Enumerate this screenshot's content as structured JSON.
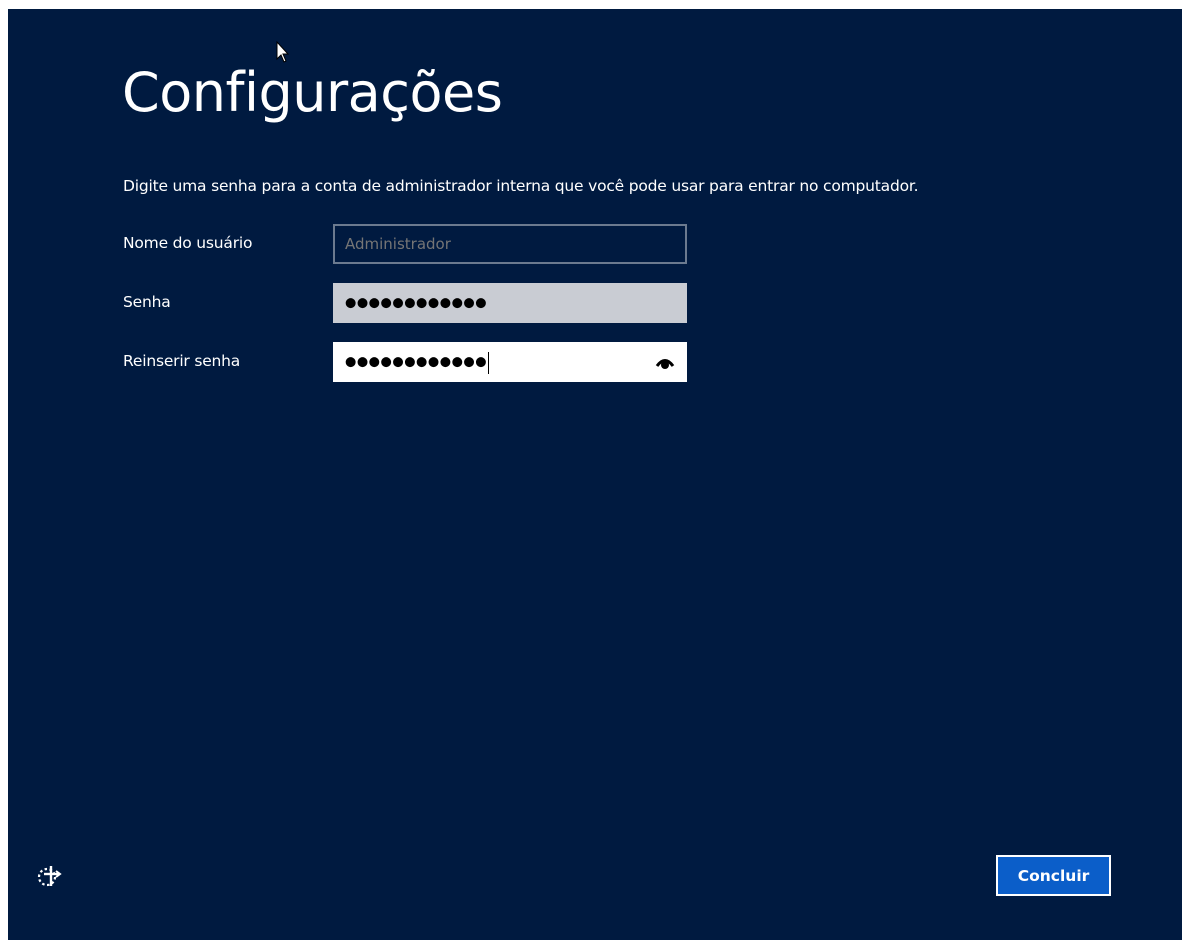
{
  "page": {
    "title": "Configurações",
    "instruction": "Digite uma senha para a conta de administrador interna que você pode usar para entrar no computador."
  },
  "form": {
    "username": {
      "label": "Nome do usuário",
      "placeholder": "Administrador"
    },
    "password": {
      "label": "Senha",
      "masked_value": "●●●●●●●●●●●●"
    },
    "confirm_password": {
      "label": "Reinserir senha",
      "masked_value": "●●●●●●●●●●●●"
    }
  },
  "buttons": {
    "finish_label": "Concluir"
  },
  "icons": {
    "reveal": "eye-icon",
    "accessibility": "ease-of-access-icon",
    "cursor": "mouse-pointer-icon"
  },
  "colors": {
    "background": "#001a40",
    "accent_button": "#0b5ec9",
    "text": "#ffffff"
  }
}
